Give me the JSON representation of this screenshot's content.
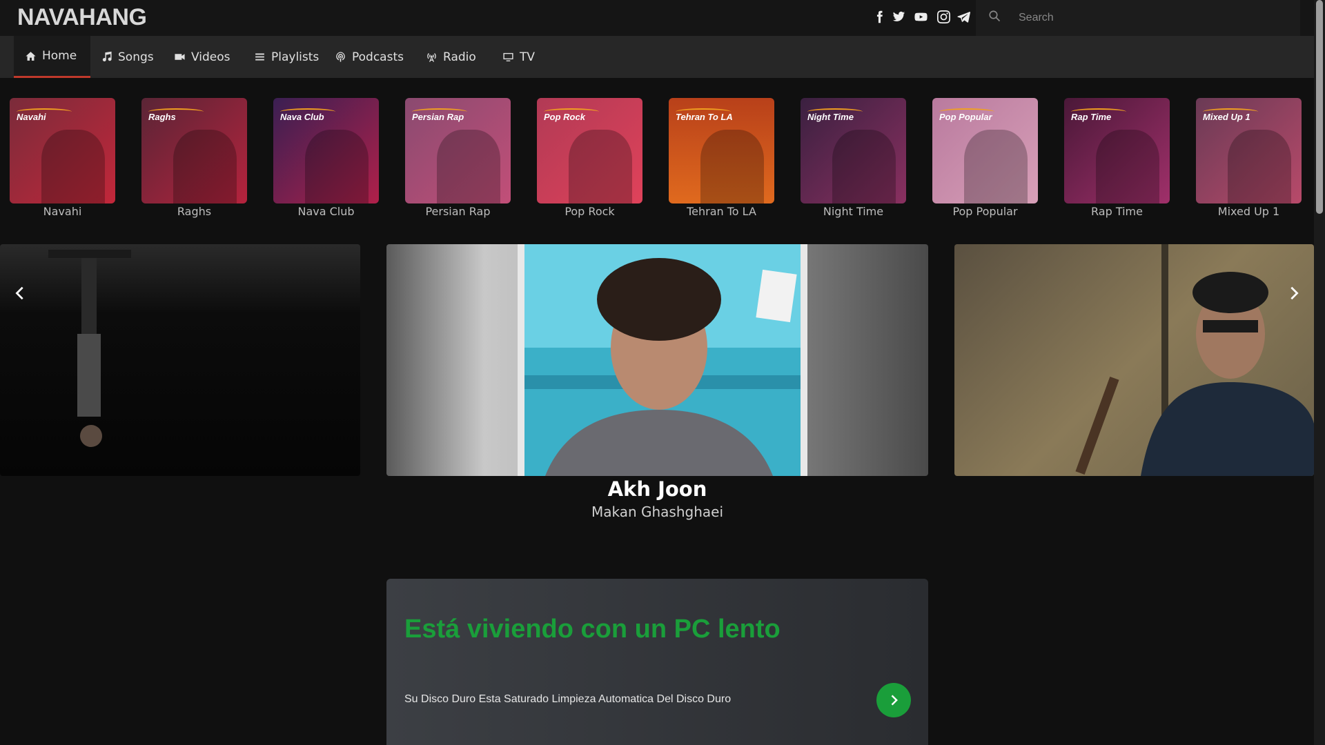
{
  "header": {
    "logo": "NAVAHANG",
    "social": [
      "facebook-icon",
      "twitter-icon",
      "youtube-icon",
      "instagram-icon",
      "telegram-icon"
    ],
    "search_placeholder": "Search"
  },
  "nav": {
    "items": [
      {
        "label": "Home",
        "icon": "home-icon",
        "active": true
      },
      {
        "label": "Songs",
        "icon": "music-icon"
      },
      {
        "label": "Videos",
        "icon": "video-icon"
      },
      {
        "label": "Playlists",
        "icon": "list-icon"
      },
      {
        "label": "Podcasts",
        "icon": "podcast-icon"
      },
      {
        "label": "Radio",
        "icon": "radio-icon"
      },
      {
        "label": "TV",
        "icon": "tv-icon"
      }
    ]
  },
  "playlists": [
    {
      "label": "Navahi",
      "tag": "Navahi",
      "colors": [
        "#7a2b3a",
        "#c2273a"
      ]
    },
    {
      "label": "Raghs",
      "tag": "Raghs",
      "colors": [
        "#5a2536",
        "#b5233d"
      ]
    },
    {
      "label": "Nava Club",
      "tag": "Nava Club",
      "colors": [
        "#3a1f52",
        "#b0204a"
      ]
    },
    {
      "label": "Persian Rap",
      "tag": "Persian Rap",
      "colors": [
        "#8a4a70",
        "#c24f78"
      ]
    },
    {
      "label": "Pop Rock",
      "tag": "Pop Rock",
      "colors": [
        "#b13a55",
        "#e0425a"
      ]
    },
    {
      "label": "Tehran To LA",
      "tag": "Tehran To LA",
      "colors": [
        "#b8401a",
        "#e06a1e"
      ]
    },
    {
      "label": "Night Time",
      "tag": "Night Time",
      "colors": [
        "#3a2040",
        "#8a3060"
      ]
    },
    {
      "label": "Pop Popular",
      "tag": "Pop Popular",
      "colors": [
        "#b97a9e",
        "#d8a0b8"
      ]
    },
    {
      "label": "Rap Time",
      "tag": "Rap Time",
      "colors": [
        "#4a1838",
        "#a0306a"
      ]
    },
    {
      "label": "Mixed Up 1",
      "tag": "Mixed Up 1",
      "colors": [
        "#6a3a55",
        "#b84a6a"
      ]
    }
  ],
  "featured": {
    "title": "Akh Joon",
    "artist": "Makan Ghashghaei"
  },
  "ad": {
    "title": "Está viviendo con un PC lento",
    "text": "Su Disco Duro Esta Saturado Limpieza Automatica Del Disco Duro",
    "accent": "#1a9e3a"
  },
  "colors": {
    "active_underline": "#c0392b",
    "background": "#101010"
  }
}
